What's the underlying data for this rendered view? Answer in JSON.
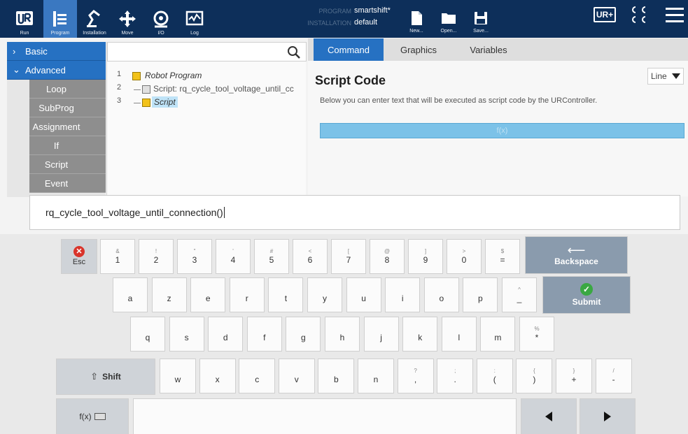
{
  "header": {
    "tools": [
      {
        "label": "Run",
        "icon": "ur-logo-icon"
      },
      {
        "label": "Program",
        "icon": "program-icon"
      },
      {
        "label": "Installation",
        "icon": "installation-icon"
      },
      {
        "label": "Move",
        "icon": "move-icon"
      },
      {
        "label": "I/O",
        "icon": "io-icon"
      },
      {
        "label": "Log",
        "icon": "log-icon"
      }
    ],
    "program_label": "PROGRAM",
    "program_value": "smartshift*",
    "installation_label": "INSTALLATION",
    "installation_value": "default",
    "file_buttons": [
      {
        "label": "New...",
        "icon": "new-file-icon"
      },
      {
        "label": "Open...",
        "icon": "folder-icon"
      },
      {
        "label": "Save...",
        "icon": "save-icon"
      }
    ],
    "ur_plus_label": "UR+",
    "menu_icon": "hamburger-menu-icon"
  },
  "leftnav": {
    "basic_label": "Basic",
    "advanced_label": "Advanced",
    "items": [
      "Loop",
      "SubProg",
      "Assignment",
      "If",
      "Script",
      "Event"
    ]
  },
  "tree": {
    "search_placeholder": "",
    "rows": [
      {
        "num": "1",
        "text": "Robot Program"
      },
      {
        "num": "2",
        "text": "Script: rq_cycle_tool_voltage_until_cc"
      },
      {
        "num": "3",
        "text": "Script"
      }
    ]
  },
  "command": {
    "tabs": [
      "Command",
      "Graphics",
      "Variables"
    ],
    "title": "Script Code",
    "mode_select": "Line",
    "description": "Below you can enter text that will be executed as script code by the URController.",
    "fx_label": "f(x)"
  },
  "script_input": {
    "value": "rq_cycle_tool_voltage_until_connection()"
  },
  "keyboard": {
    "esc_label": "Esc",
    "backspace_label": "Backspace",
    "submit_label": "Submit",
    "shift_label": "Shift",
    "fx_label": "f(x)",
    "row1": [
      {
        "sec": "&",
        "pri": "1"
      },
      {
        "sec": "!",
        "pri": "2"
      },
      {
        "sec": "\"",
        "pri": "3"
      },
      {
        "sec": "'",
        "pri": "4"
      },
      {
        "sec": "#",
        "pri": "5"
      },
      {
        "sec": "<",
        "pri": "6"
      },
      {
        "sec": "[",
        "pri": "7"
      },
      {
        "sec": "@",
        "pri": "8"
      },
      {
        "sec": "]",
        "pri": "9"
      },
      {
        "sec": ">",
        "pri": "0"
      },
      {
        "sec": "$",
        "pri": "="
      }
    ],
    "row2": [
      {
        "sec": "",
        "pri": "a"
      },
      {
        "sec": "",
        "pri": "z"
      },
      {
        "sec": "",
        "pri": "e"
      },
      {
        "sec": "",
        "pri": "r"
      },
      {
        "sec": "",
        "pri": "t"
      },
      {
        "sec": "",
        "pri": "y"
      },
      {
        "sec": "",
        "pri": "u"
      },
      {
        "sec": "",
        "pri": "i"
      },
      {
        "sec": "",
        "pri": "o"
      },
      {
        "sec": "",
        "pri": "p"
      },
      {
        "sec": "^",
        "pri": "_"
      }
    ],
    "row3": [
      {
        "sec": "",
        "pri": "q"
      },
      {
        "sec": "",
        "pri": "s"
      },
      {
        "sec": "",
        "pri": "d"
      },
      {
        "sec": "",
        "pri": "f"
      },
      {
        "sec": "",
        "pri": "g"
      },
      {
        "sec": "",
        "pri": "h"
      },
      {
        "sec": "",
        "pri": "j"
      },
      {
        "sec": "",
        "pri": "k"
      },
      {
        "sec": "",
        "pri": "l"
      },
      {
        "sec": "",
        "pri": "m"
      },
      {
        "sec": "%",
        "pri": "*"
      }
    ],
    "row4": [
      {
        "sec": "",
        "pri": "w"
      },
      {
        "sec": "",
        "pri": "x"
      },
      {
        "sec": "",
        "pri": "c"
      },
      {
        "sec": "",
        "pri": "v"
      },
      {
        "sec": "",
        "pri": "b"
      },
      {
        "sec": "",
        "pri": "n"
      },
      {
        "sec": "?",
        "pri": ","
      },
      {
        "sec": ";",
        "pri": "."
      },
      {
        "sec": ":",
        "pri": "("
      },
      {
        "sec": "{",
        "pri": ")"
      },
      {
        "sec": "}",
        "pri": "+"
      },
      {
        "sec": "/",
        "pri": "-"
      }
    ]
  },
  "colors": {
    "header_bg": "#0d2f5a",
    "accent_blue": "#2671c2",
    "nav_gray": "#8e8e8e",
    "submit_green": "#3aa842",
    "esc_red": "#d9342b"
  }
}
